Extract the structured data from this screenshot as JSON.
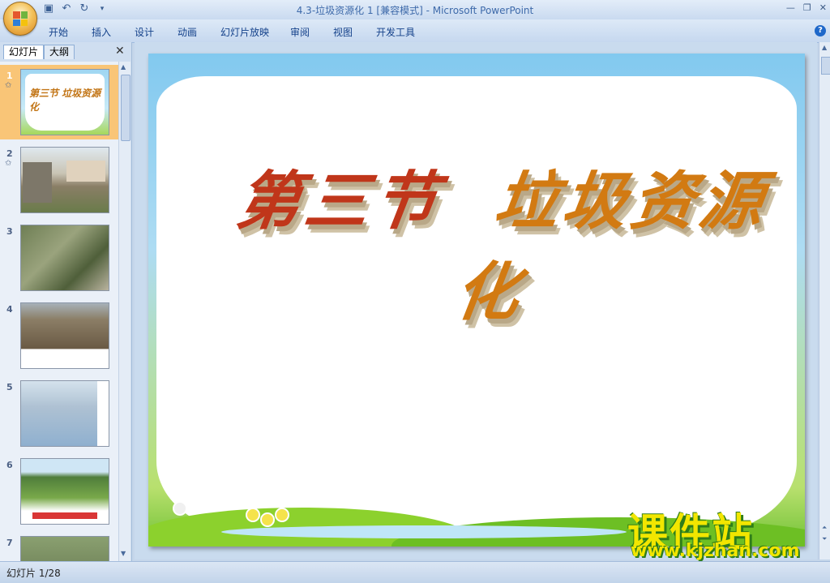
{
  "window": {
    "title": "4.3-垃圾资源化 1 [兼容模式] - Microsoft PowerPoint"
  },
  "quick_access": {
    "icons": [
      "save-icon",
      "undo-icon",
      "redo-icon",
      "customize-icon"
    ]
  },
  "ribbon": {
    "tabs": [
      "开始",
      "插入",
      "设计",
      "动画",
      "幻灯片放映",
      "审阅",
      "视图",
      "开发工具"
    ]
  },
  "left_pane": {
    "tabs": [
      "幻灯片",
      "大纲"
    ],
    "thumbnails": [
      {
        "number": "1",
        "has_animation": true
      },
      {
        "number": "2",
        "has_animation": true
      },
      {
        "number": "3",
        "has_animation": false
      },
      {
        "number": "4",
        "has_animation": false
      },
      {
        "number": "5",
        "has_animation": false
      },
      {
        "number": "6",
        "has_animation": false
      },
      {
        "number": "7",
        "has_animation": false
      }
    ],
    "selected": "1"
  },
  "slide": {
    "title_part1": "第三节",
    "title_part2": "垃圾资源化"
  },
  "watermark": {
    "cn": "课件站",
    "url": "www.kjzhan.com"
  },
  "status": {
    "slide_counter": "幻灯片 1/28"
  },
  "colors": {
    "ribbon_bg": "#c6d8ef",
    "selected_thumb": "#f9c577",
    "title_orange": "#d27a12",
    "title_red": "#c0361a"
  }
}
